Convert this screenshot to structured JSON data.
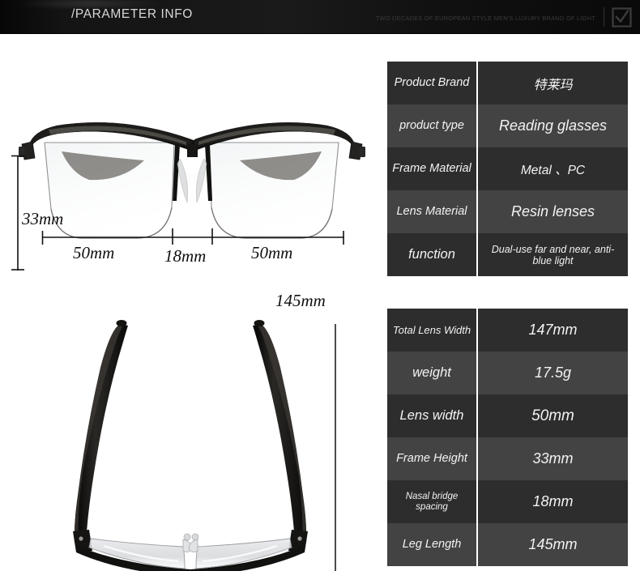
{
  "header": {
    "title": "/PARAMETER INFO",
    "tagline": "TWO DECADES OF EUROPEAN STYLE MEN'S LUXURY BRAND OF LIGHT",
    "logo_icon": "checked-square-logo-icon"
  },
  "diagram": {
    "front_view": {
      "icon": "eyeglasses-front-view",
      "height_label": "33mm",
      "lens_left_label": "50mm",
      "bridge_label": "18mm",
      "lens_right_label": "50mm"
    },
    "top_view": {
      "icon": "eyeglasses-top-view",
      "temple_length_label": "145mm"
    }
  },
  "spec_tables": [
    {
      "name": "product-spec-table",
      "rows": [
        {
          "label": "Product Brand",
          "value": "特莱玛"
        },
        {
          "label": "product type",
          "value": "Reading glasses"
        },
        {
          "label": "Frame Material",
          "value": "Metal 、PC"
        },
        {
          "label": "Lens Material",
          "value": "Resin lenses"
        },
        {
          "label": "function",
          "value": "Dual-use far and near, anti-blue light"
        }
      ]
    },
    {
      "name": "dimension-spec-table",
      "rows": [
        {
          "label": "Total Lens Width",
          "value": "147mm"
        },
        {
          "label": "weight",
          "value": "17.5g"
        },
        {
          "label": "Lens width",
          "value": "50mm"
        },
        {
          "label": "Frame Height",
          "value": "33mm"
        },
        {
          "label": "Nasal bridge spacing",
          "value": "18mm"
        },
        {
          "label": "Leg Length",
          "value": "145mm"
        }
      ]
    }
  ],
  "colors": {
    "header_bg": "#0d0d0d",
    "row_dark": "#2d2d2d",
    "row_light": "#434343",
    "text_light": "#f3f3f3",
    "divider": "#ffffff",
    "page_bg": "#ffffff"
  }
}
